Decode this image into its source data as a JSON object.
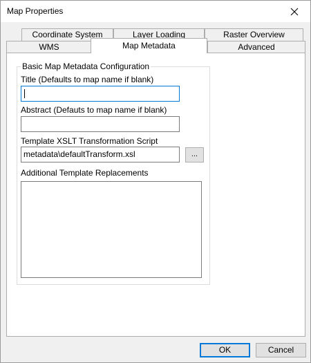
{
  "window": {
    "title": "Map Properties"
  },
  "tabs": {
    "row1": [
      "Coordinate System",
      "Layer Loading",
      "Raster Overview"
    ],
    "row2": [
      "WMS",
      "Map Metadata",
      "Advanced"
    ],
    "active": "Map Metadata"
  },
  "group": {
    "legend": "Basic Map Metadata Configuration",
    "title_label": "Title (Defaults to map name if blank)",
    "title_value": "",
    "abstract_label": "Abstract (Defauts to map name if blank)",
    "abstract_value": "",
    "xslt_label": "Template XSLT Transformation Script",
    "xslt_value": "metadata\\defaultTransform.xsl",
    "browse_label": "...",
    "replacements_label": "Additional Template Replacements",
    "replacements_value": ""
  },
  "buttons": {
    "ok": "OK",
    "cancel": "Cancel"
  },
  "icons": {
    "close": "close-icon"
  }
}
